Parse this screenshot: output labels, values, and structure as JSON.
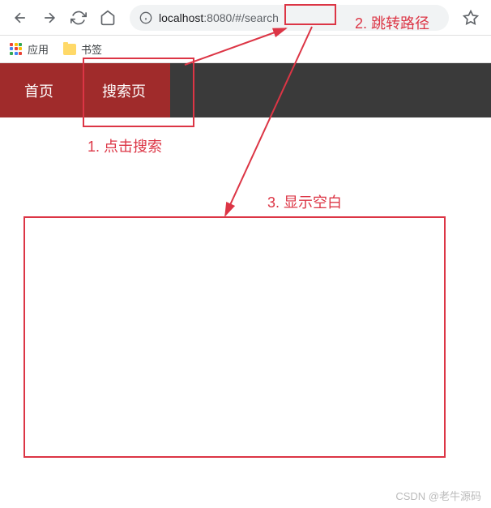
{
  "browser": {
    "url_host": "localhost",
    "url_port": ":8080",
    "url_hash": "/#/search"
  },
  "bookmarks": {
    "apps_label": "应用",
    "folder_label": "书签"
  },
  "nav": {
    "items": [
      {
        "label": "首页"
      },
      {
        "label": "搜索页"
      }
    ]
  },
  "annotations": {
    "a1": "1. 点击搜索",
    "a2": "2. 跳转路径",
    "a3": "3. 显示空白"
  },
  "watermark": "CSDN @老牛源码"
}
